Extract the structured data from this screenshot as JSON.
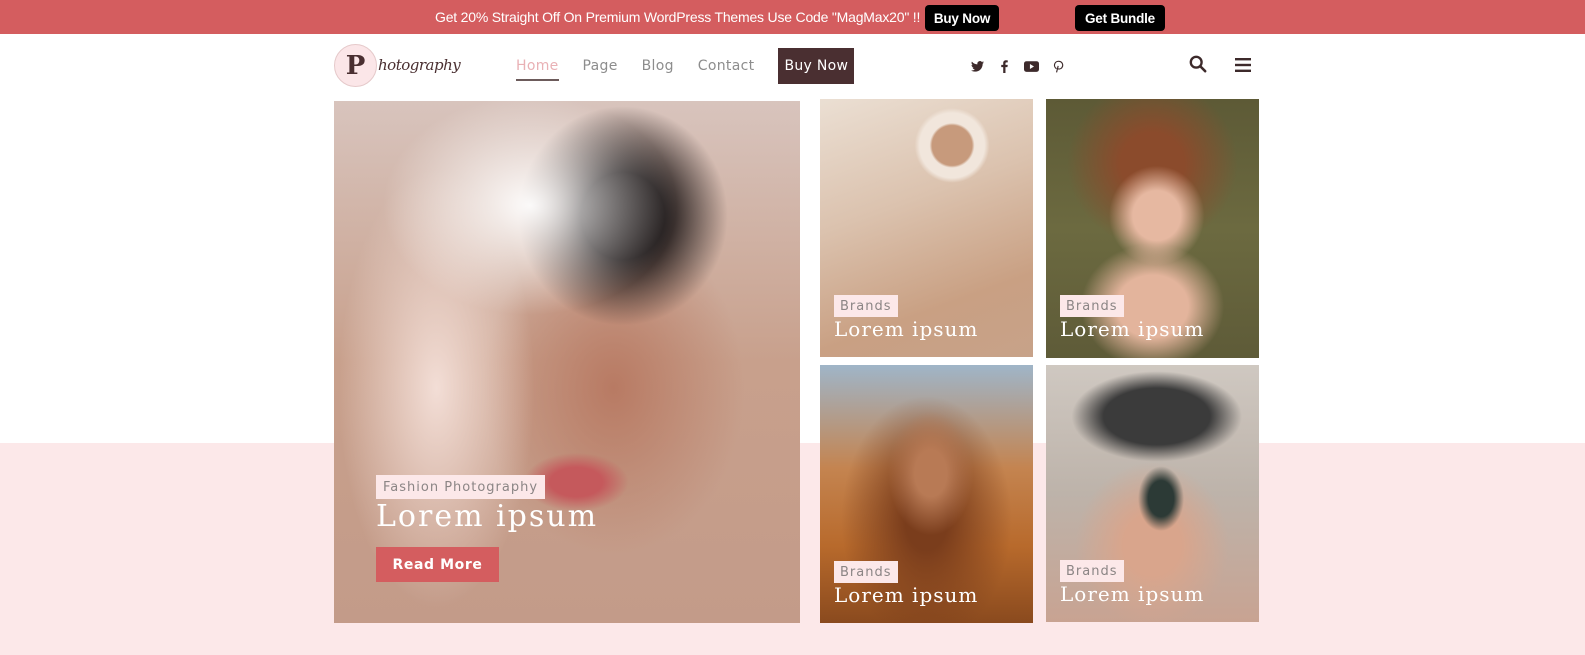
{
  "promo": {
    "text": "Get 20% Straight Off On Premium WordPress Themes Use Code \"MagMax20\" !!",
    "buy_now": "Buy Now",
    "get_bundle": "Get Bundle",
    "background_color": "#d45d5f"
  },
  "header": {
    "logo": {
      "initial": "P",
      "script": "hotography"
    },
    "nav": [
      {
        "label": "Home",
        "active": true
      },
      {
        "label": "Page",
        "active": false
      },
      {
        "label": "Blog",
        "active": false
      },
      {
        "label": "Contact",
        "active": false
      }
    ],
    "buy_now": "Buy Now",
    "social": [
      "twitter-icon",
      "facebook-icon",
      "youtube-icon",
      "pinterest-icon"
    ],
    "icons": {
      "search": "search-icon",
      "menu": "hamburger-menu-icon"
    }
  },
  "hero": {
    "main": {
      "tag": "Fashion Photography",
      "title": "Lorem ipsum",
      "button": "Read More"
    },
    "tiles": [
      {
        "tag": "Brands",
        "title": "Lorem ipsum"
      },
      {
        "tag": "Brands",
        "title": "Lorem ipsum"
      },
      {
        "tag": "Brands",
        "title": "Lorem ipsum"
      },
      {
        "tag": "Brands",
        "title": "Lorem ipsum"
      }
    ]
  },
  "colors": {
    "accent": "#d45d5f",
    "dark": "#4a2f31",
    "pink_bg": "#fce8e9",
    "nav_active": "#e9b1b5"
  }
}
